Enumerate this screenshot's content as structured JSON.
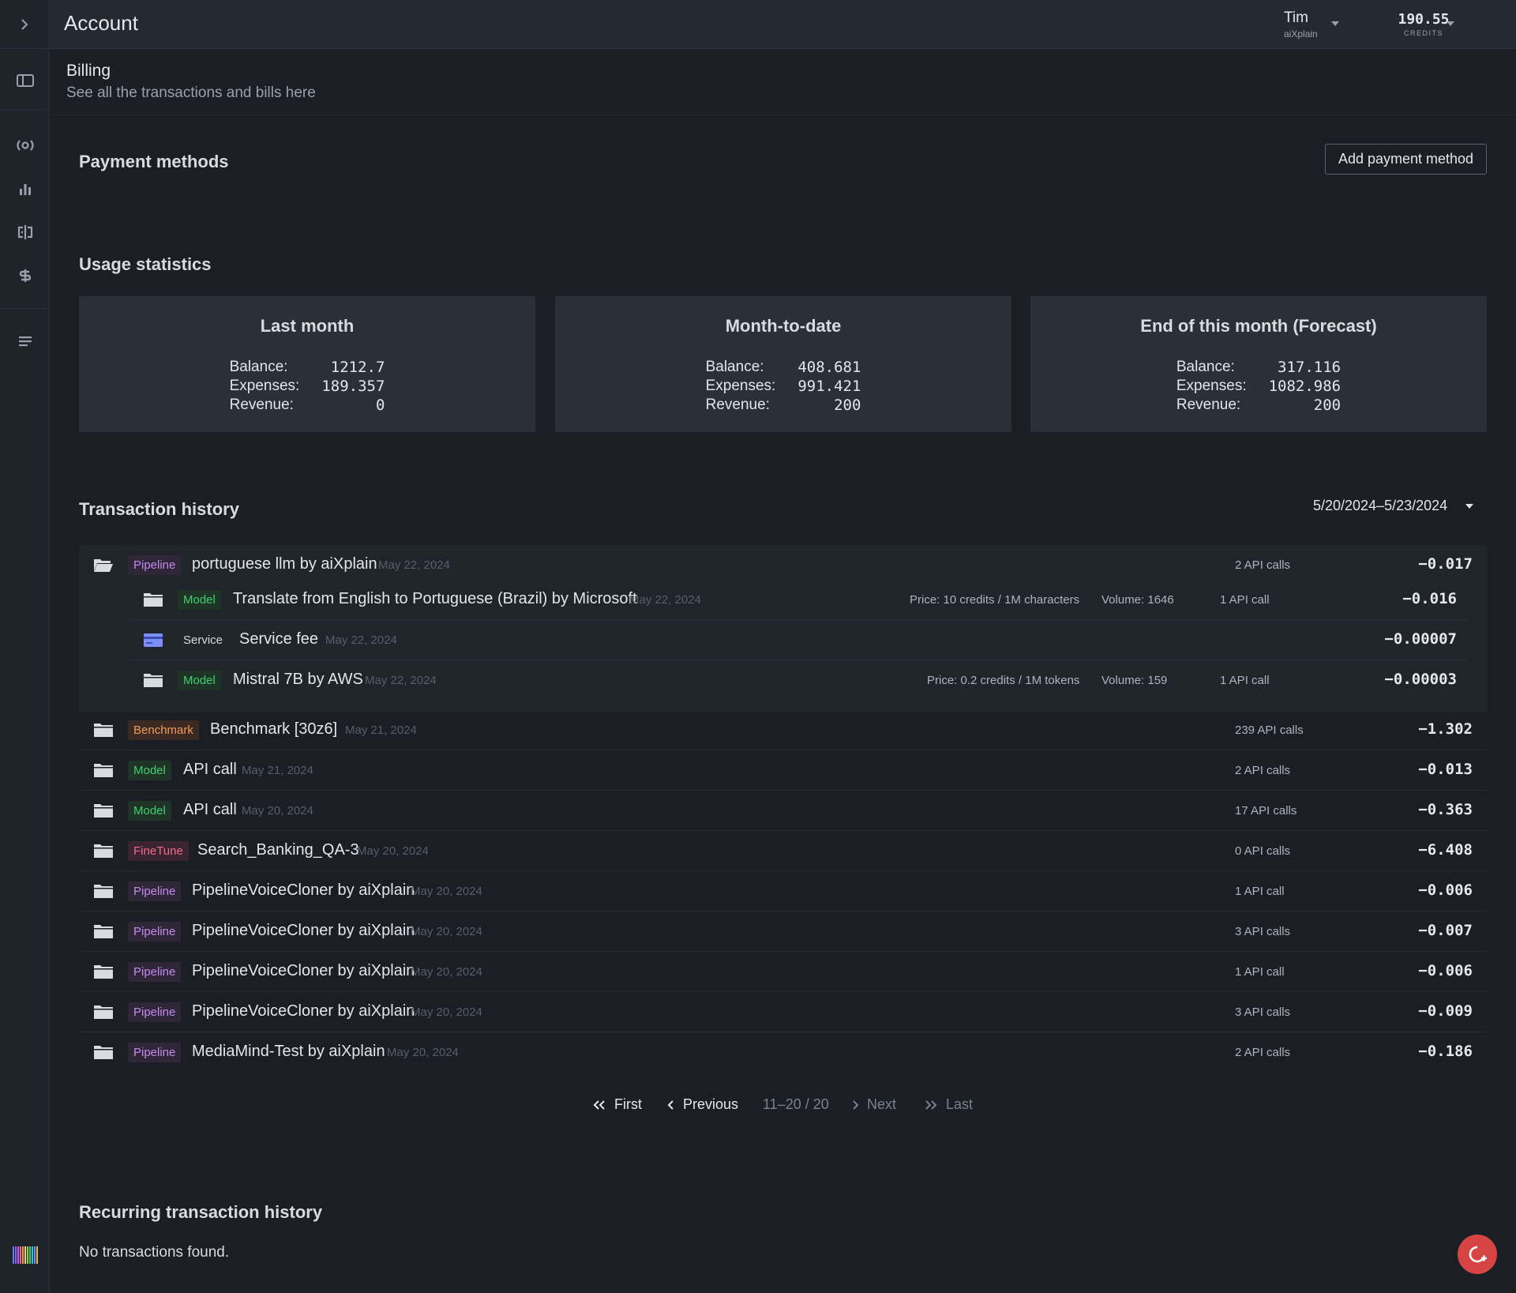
{
  "header": {
    "title": "Account",
    "user_name": "Tim",
    "user_org": "aiXplain",
    "credits_value": "190.55",
    "credits_label": "CREDITS"
  },
  "subheader": {
    "title": "Billing",
    "description": "See all the transactions and bills here"
  },
  "payment_methods": {
    "title": "Payment methods",
    "add_button": "Add payment method"
  },
  "usage": {
    "title": "Usage statistics",
    "labels": {
      "balance": "Balance:",
      "expenses": "Expenses:",
      "revenue": "Revenue:"
    },
    "cards": [
      {
        "title": "Last month",
        "balance": "1212.7",
        "expenses": "189.357",
        "revenue": "0"
      },
      {
        "title": "Month-to-date",
        "balance": "408.681",
        "expenses": "991.421",
        "revenue": "200"
      },
      {
        "title": "End of this month (Forecast)",
        "balance": "317.116",
        "expenses": "1082.986",
        "revenue": "200"
      }
    ]
  },
  "transactions": {
    "title": "Transaction history",
    "date_range": "5/20/2024–5/23/2024",
    "group": {
      "badge": "Pipeline",
      "name": "portuguese llm by aiXplain",
      "date": "May 22, 2024",
      "calls": "2 API calls",
      "amount": "−0.017",
      "children": [
        {
          "badge": "Model",
          "name": "Translate from English to Portuguese (Brazil) by Microsoft",
          "date": "May 22, 2024",
          "price_label": "Price:",
          "price": "10 credits",
          "price_unit": "/ 1M characters",
          "volume_label": "Volume:",
          "volume": "1646",
          "calls": "1 API call",
          "amount": "−0.016"
        },
        {
          "badge": "Service",
          "name": "Service fee",
          "date": "May 22, 2024",
          "amount": "−0.00007"
        },
        {
          "badge": "Model",
          "name": "Mistral 7B by AWS",
          "date": "May 22, 2024",
          "price_label": "Price:",
          "price": "0.2 credits",
          "price_unit": "/ 1M tokens",
          "volume_label": "Volume:",
          "volume": "159",
          "calls": "1 API call",
          "amount": "−0.00003"
        }
      ]
    },
    "rows": [
      {
        "badge": "Benchmark",
        "name": "Benchmark [30z6]",
        "date": "May 21, 2024",
        "calls": "239 API calls",
        "amount": "−1.302"
      },
      {
        "badge": "Model",
        "name": "API call",
        "date": "May 21, 2024",
        "calls": "2 API calls",
        "amount": "−0.013"
      },
      {
        "badge": "Model",
        "name": "API call",
        "date": "May 20, 2024",
        "calls": "17 API calls",
        "amount": "−0.363"
      },
      {
        "badge": "FineTune",
        "name": "Search_Banking_QA-3",
        "date": "May 20, 2024",
        "calls": "0 API calls",
        "amount": "−6.408"
      },
      {
        "badge": "Pipeline",
        "name": "PipelineVoiceCloner by aiXplain",
        "date": "May 20, 2024",
        "calls": "1 API call",
        "amount": "−0.006"
      },
      {
        "badge": "Pipeline",
        "name": "PipelineVoiceCloner by aiXplain",
        "date": "May 20, 2024",
        "calls": "3 API calls",
        "amount": "−0.007"
      },
      {
        "badge": "Pipeline",
        "name": "PipelineVoiceCloner by aiXplain",
        "date": "May 20, 2024",
        "calls": "1 API call",
        "amount": "−0.006"
      },
      {
        "badge": "Pipeline",
        "name": "PipelineVoiceCloner by aiXplain",
        "date": "May 20, 2024",
        "calls": "3 API calls",
        "amount": "−0.009"
      },
      {
        "badge": "Pipeline",
        "name": "MediaMind-Test by aiXplain",
        "date": "May 20, 2024",
        "calls": "2 API calls",
        "amount": "−0.186"
      }
    ],
    "pagination": {
      "first": "First",
      "previous": "Previous",
      "range": "11–20 / 20",
      "next": "Next",
      "last": "Last"
    }
  },
  "recurring": {
    "title": "Recurring transaction history",
    "empty": "No transactions found."
  },
  "colors": {
    "pipeline": "#c58af0",
    "model": "#3fcf72",
    "benchmark": "#f29a5a",
    "finetune": "#f06a8a",
    "fab": "#d64444"
  }
}
